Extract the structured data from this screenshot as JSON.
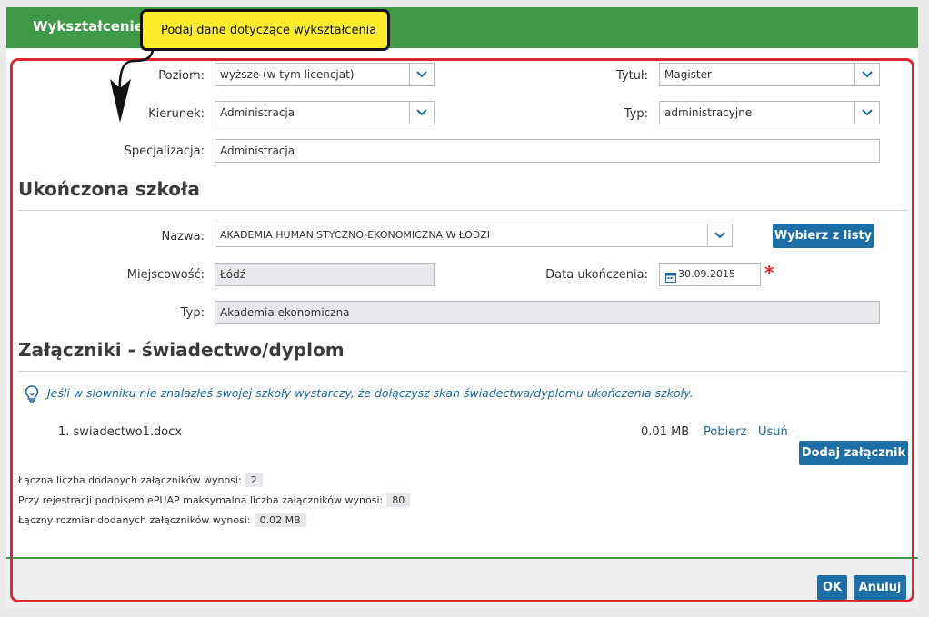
{
  "dialog": {
    "title": "Wykształcenie"
  },
  "callout": {
    "text": "Podaj dane dotyczące wykształcenia"
  },
  "education": {
    "poziom_label": "Poziom:",
    "poziom_value": "wyższe (w tym licencjat)",
    "tytul_label": "Tytuł:",
    "tytul_value": "Magister",
    "kierunek_label": "Kierunek:",
    "kierunek_value": "Administracja",
    "typ_label": "Typ:",
    "typ_value": "administracyjne",
    "specjalizacja_label": "Specjalizacja:",
    "specjalizacja_value": "Administracja"
  },
  "school": {
    "section_title": "Ukończona szkoła",
    "nazwa_label": "Nazwa:",
    "nazwa_value": "AKADEMIA HUMANISTYCZNO-EKONOMICZNA W ŁODZI",
    "choose_button": "Wybierz z listy",
    "miejscowosc_label": "Miejscowość:",
    "miejscowosc_value": "Łódź",
    "data_label": "Data ukończenia:",
    "data_value": "30.09.2015",
    "required_mark": "*",
    "typ_label": "Typ:",
    "typ_value": "Akademia ekonomiczna"
  },
  "attachments": {
    "section_title": "Załączniki - świadectwo/dyplom",
    "info": "Jeśli w słowniku nie znalazłeś swojej szkoły wystarczy, że dołączysz skan świadectwa/dyplomu ukończenia szkoły.",
    "files": [
      {
        "name": "1. swiadectwo1.docx",
        "size": "0.01 MB",
        "download": "Pobierz",
        "remove": "Usuń"
      }
    ],
    "add_button": "Dodaj załącznik",
    "count_label": "Łączna liczba dodanych załączników wynosi:",
    "count_value": "2",
    "max_label": "Przy rejestracji podpisem ePUAP maksymalna liczba załączników wynosi:",
    "max_value": "80",
    "size_label": "Łączny rozmiar dodanych załączników wynosi:",
    "size_value": "0.02 MB"
  },
  "footer": {
    "ok": "OK",
    "cancel": "Anuluj"
  },
  "colors": {
    "header_green": "#3e9a46",
    "button_blue": "#1b6ea6",
    "highlight_red": "#e0262f",
    "callout_yellow": "#ffec2b"
  }
}
